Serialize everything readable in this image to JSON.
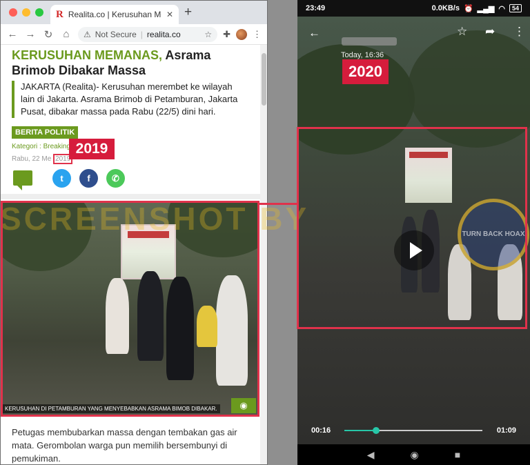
{
  "browser": {
    "tab_title": "Realita.co | Kerusuhan Memanas, Asrama Brimob Dibakar Massa",
    "tab_favicon": "R",
    "new_tab": "+",
    "security_label": "Not Secure",
    "domain": "realita.co"
  },
  "article": {
    "headline_green": "KERUSUHAN MEMANAS,",
    "headline_rest": "Asrama Brimob Dibakar Massa",
    "lead": "JAKARTA (Realita)- Kerusuhan merembet ke wilayah lain di Jakarta.  Asrama Brimob di Petamburan, Jakarta Pusat,  dibakar massa pada Rabu (22/5) dini hari.",
    "category_badge": "BERITA POLITIK",
    "kategori": "Kategori : Breaking",
    "date_prefix": "Rabu, 22 Me",
    "date_year": "2019",
    "photo_caption": "KERUSUHAN DI PETAMBURAN YANG MENYEBABKAN ASRAMA BIMOB DIBAKAR.",
    "body": "Petugas membubarkan massa dengan tembakan gas air mata. Gerombolan warga pun memilih bersembunyi di pemukiman."
  },
  "annotations": {
    "year_left": "2019",
    "year_right": "2020",
    "watermark": "SCREENSHOT BY",
    "seal_text": "TURN BACK HOAX"
  },
  "phone": {
    "clock": "23:49",
    "net_speed": "0.0KB/s",
    "battery": "54",
    "timestamp": "Today, 16:36",
    "time_current": "00:16",
    "time_total": "01:09",
    "progress_fraction": 0.23
  },
  "icons": {
    "back": "arrow-left-icon",
    "star": "star-icon",
    "share": "share-icon",
    "more": "more-vert-icon",
    "play": "play-icon",
    "camera": "camera-icon"
  },
  "colors": {
    "highlight_red": "#e0324b",
    "tag_red": "#d61c3c",
    "brand_green": "#6b9a1e",
    "seek_accent": "#27c7a8"
  }
}
